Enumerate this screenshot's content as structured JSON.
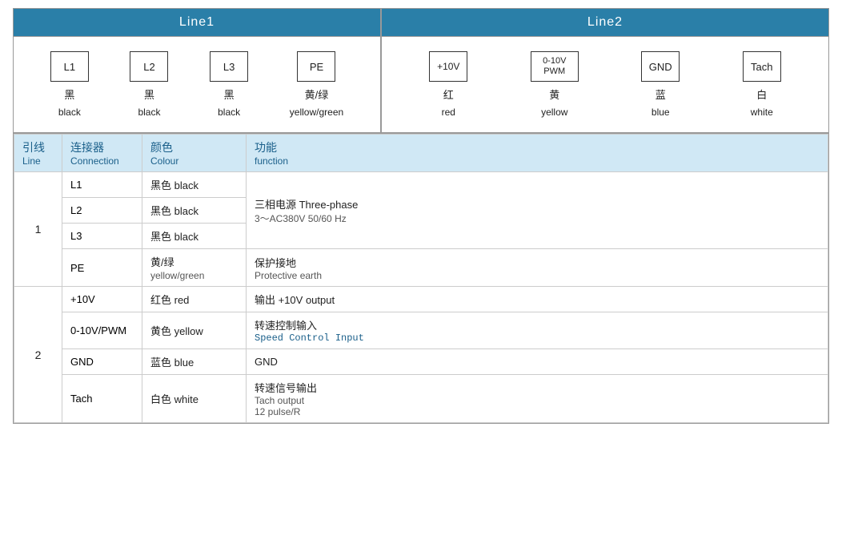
{
  "header": {
    "line1_label": "Line1",
    "line2_label": "Line2"
  },
  "line1_connectors": [
    {
      "id": "c-L1",
      "box_label": "L1",
      "cn": "黑",
      "en": "black"
    },
    {
      "id": "c-L2",
      "box_label": "L2",
      "cn": "黑",
      "en": "black"
    },
    {
      "id": "c-L3",
      "box_label": "L3",
      "cn": "黑",
      "en": "black"
    },
    {
      "id": "c-PE",
      "box_label": "PE",
      "cn": "黄/绿",
      "en": "yellow/green"
    }
  ],
  "line2_connectors": [
    {
      "id": "c-10V",
      "box_label": "+10V",
      "cn": "红",
      "en": "red",
      "wide": false
    },
    {
      "id": "c-PWM",
      "box_line1": "0-10V",
      "box_line2": "PWM",
      "cn": "黄",
      "en": "yellow",
      "wide": true
    },
    {
      "id": "c-GND",
      "box_label": "GND",
      "cn": "蓝",
      "en": "blue",
      "wide": false
    },
    {
      "id": "c-Tach",
      "box_label": "Tach",
      "cn": "白",
      "en": "white",
      "wide": false
    }
  ],
  "table": {
    "headers": [
      {
        "cn": "引线",
        "en": "Line"
      },
      {
        "cn": "连接器",
        "en": "Connection"
      },
      {
        "cn": "颜色",
        "en": "Colour"
      },
      {
        "cn": "功能",
        "en": "function"
      }
    ],
    "rows": [
      {
        "line": "1",
        "rowspan": 4,
        "entries": [
          {
            "connection": "L1",
            "colour_cn": "黑色 black",
            "func_cn": "三相电源 Three-phase",
            "func_en": "3～AC380V 50/60 Hz",
            "rowspan": 3
          },
          {
            "connection": "L2",
            "colour_cn": "黑色 black",
            "func_cn": "",
            "func_en": ""
          },
          {
            "connection": "L3",
            "colour_cn": "黑色 black",
            "func_cn": "",
            "func_en": ""
          },
          {
            "connection": "PE",
            "colour_cn": "黄/绿",
            "colour_en": "yellow/green",
            "func_cn": "保护接地",
            "func_en": "Protective earth",
            "rowspan": 1
          }
        ]
      },
      {
        "line": "2",
        "rowspan": 4,
        "entries": [
          {
            "connection": "+10V",
            "colour_cn": "红色 red",
            "func_cn": "输出 +10V output",
            "func_en": ""
          },
          {
            "connection": "0-10V/PWM",
            "colour_cn": "黄色 yellow",
            "func_cn": "转速控制输入",
            "func_en": "Speed Control Input",
            "mono": true
          },
          {
            "connection": "GND",
            "colour_cn": "蓝色 blue",
            "func_cn": "GND",
            "func_en": ""
          },
          {
            "connection": "Tach",
            "colour_cn": "白色 white",
            "func_cn": "转速信号输出",
            "func_en": "Tach output\n12 pulse/R"
          }
        ]
      }
    ]
  }
}
